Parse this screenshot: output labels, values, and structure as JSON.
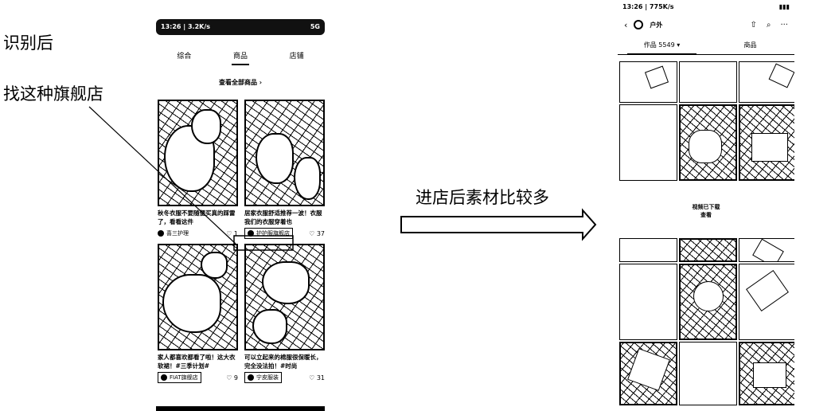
{
  "annotations": {
    "after_recognition": "识别后",
    "find_flagship": "找这种旗舰店",
    "after_entering": "进店后素材比较多"
  },
  "left_phone": {
    "status_time": "13:26 | 3.2K/s",
    "status_right": "5G",
    "tabs": [
      "综合",
      "商品",
      "店铺"
    ],
    "view_all": "查看全部商品 ›",
    "cards": [
      {
        "caption": "秋冬衣服不要随便买真的踩雷了，看看这件",
        "author": "喜三护理",
        "likes": "1"
      },
      {
        "caption": "居家衣服舒适推荐一波！衣服我们的衣服穿着也",
        "author": "护护服旗舰店",
        "likes": "37"
      },
      {
        "caption": "家人都喜欢都看了啦！这大衣软裙！#三季计划#",
        "author": "FIAT旗舰店",
        "likes": "9"
      },
      {
        "caption": "可以立起来的棉服很保暖长，完全没法拍！#时尚",
        "author": "宁皮服装",
        "likes": "31"
      }
    ]
  },
  "right_phone": {
    "status_time": "13:26 | 775K/s",
    "shop_name": "户外",
    "tabs": [
      "作品 5549 ▾",
      "商品"
    ],
    "popup_line1": "视频已下载",
    "popup_line2": "查看"
  },
  "colors": {
    "ink": "#000000",
    "paper": "#ffffff"
  }
}
